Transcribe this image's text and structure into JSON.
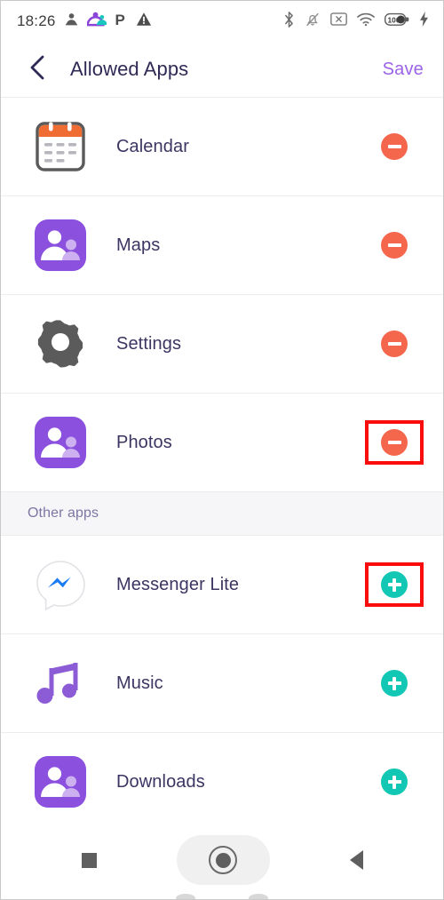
{
  "statusbar": {
    "time": "18:26",
    "left_icons": [
      "contact-silhouette-icon",
      "people-color-icon",
      "parking-p-icon",
      "warning-triangle-icon"
    ],
    "right_icons": [
      "bluetooth-icon",
      "vibrate-off-icon",
      "no-sim-icon",
      "wifi-icon",
      "battery-icon",
      "charging-bolt-icon"
    ],
    "battery_level": "100"
  },
  "header": {
    "back_icon": "chevron-left-icon",
    "title": "Allowed Apps",
    "save_label": "Save"
  },
  "colors": {
    "accent_purple": "#9b63e8",
    "title_navy": "#2f2a55",
    "remove_orange": "#f4674c",
    "add_teal": "#12c7b4",
    "highlight_red": "#fc0d0d",
    "band_gray": "#f6f6f8"
  },
  "allowed_apps": [
    {
      "name": "Calendar",
      "icon": "calendar-app-icon",
      "action": "remove",
      "action_icon": "minus-circle-icon",
      "highlighted": false
    },
    {
      "name": "Maps",
      "icon": "people-placeholder-app-icon",
      "action": "remove",
      "action_icon": "minus-circle-icon",
      "highlighted": false
    },
    {
      "name": "Settings",
      "icon": "gear-app-icon",
      "action": "remove",
      "action_icon": "minus-circle-icon",
      "highlighted": false
    },
    {
      "name": "Photos",
      "icon": "people-placeholder-app-icon",
      "action": "remove",
      "action_icon": "minus-circle-icon",
      "highlighted": true
    }
  ],
  "section": {
    "label": "Other apps"
  },
  "other_apps": [
    {
      "name": "Messenger Lite",
      "icon": "messenger-lite-app-icon",
      "action": "add",
      "action_icon": "plus-circle-icon",
      "highlighted": true
    },
    {
      "name": "Music",
      "icon": "music-note-app-icon",
      "action": "add",
      "action_icon": "plus-circle-icon",
      "highlighted": false
    },
    {
      "name": "Downloads",
      "icon": "people-placeholder-app-icon",
      "action": "add",
      "action_icon": "plus-circle-icon",
      "highlighted": false
    }
  ],
  "navbar": {
    "recents_icon": "square-recents-icon",
    "home_icon": "home-circle-icon",
    "back_icon": "triangle-back-icon"
  }
}
